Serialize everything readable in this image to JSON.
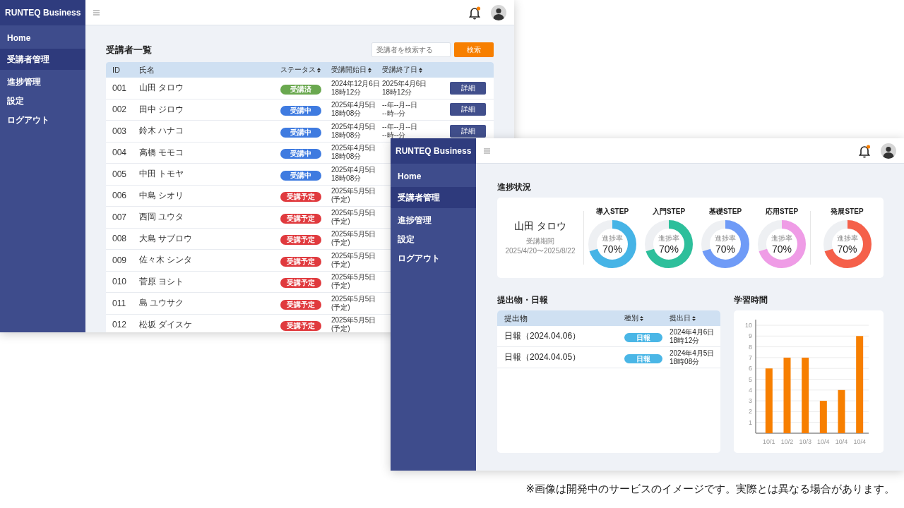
{
  "student_list_window": {
    "brand": "RUNTEQ Business",
    "notification": true,
    "sidebar": [
      {
        "label": "Home",
        "selected": false
      },
      {
        "label": "受講者管理",
        "selected": true
      },
      {
        "label": "進捗管理",
        "selected": false
      },
      {
        "label": "設定",
        "selected": false
      },
      {
        "label": "ログアウト",
        "selected": false
      }
    ],
    "title": "受講者一覧",
    "search": {
      "placeholder": "受講者を検索する"
    },
    "search_button": "検索",
    "table": {
      "columns": [
        {
          "label": "ID",
          "sortable": false
        },
        {
          "label": "氏名",
          "sortable": false
        },
        {
          "label": "ステータス",
          "sortable": true
        },
        {
          "label": "受講開始日",
          "sortable": true
        },
        {
          "label": "受講終了日",
          "sortable": true
        }
      ],
      "rows": [
        {
          "id": "001",
          "name": "山田 タロウ",
          "status": {
            "label": "受講済",
            "kind": "done"
          },
          "start": [
            "2024年12月6日",
            "18時12分"
          ],
          "end": [
            "2025年4月6日",
            "18時12分"
          ],
          "button": "詳細"
        },
        {
          "id": "002",
          "name": "田中 ジロウ",
          "status": {
            "label": "受講中",
            "kind": "active"
          },
          "start": [
            "2025年4月5日",
            "18時08分"
          ],
          "end": [
            "--年--月--日",
            "--時--分"
          ],
          "button": "詳細"
        },
        {
          "id": "003",
          "name": "鈴木 ハナコ",
          "status": {
            "label": "受講中",
            "kind": "active"
          },
          "start": [
            "2025年4月5日",
            "18時08分"
          ],
          "end": [
            "--年--月--日",
            "--時--分"
          ],
          "button": "詳細"
        },
        {
          "id": "004",
          "name": "高橋 モモコ",
          "status": {
            "label": "受講中",
            "kind": "active"
          },
          "start": [
            "2025年4月5日",
            "18時08分"
          ]
        },
        {
          "id": "005",
          "name": "中田 トモヤ",
          "status": {
            "label": "受講中",
            "kind": "active"
          },
          "start": [
            "2025年4月5日",
            "18時08分"
          ]
        },
        {
          "id": "006",
          "name": "中島 シオリ",
          "status": {
            "label": "受講予定",
            "kind": "planned"
          },
          "start": [
            "2025年5月5日",
            "(予定)"
          ]
        },
        {
          "id": "007",
          "name": "西岡 ユウタ",
          "status": {
            "label": "受講予定",
            "kind": "planned"
          },
          "start": [
            "2025年5月5日",
            "(予定)"
          ]
        },
        {
          "id": "008",
          "name": "大島 サブロウ",
          "status": {
            "label": "受講予定",
            "kind": "planned"
          },
          "start": [
            "2025年5月5日",
            "(予定)"
          ]
        },
        {
          "id": "009",
          "name": "佐々木 シンタ",
          "status": {
            "label": "受講予定",
            "kind": "planned"
          },
          "start": [
            "2025年5月5日",
            "(予定)"
          ]
        },
        {
          "id": "010",
          "name": "菅原 ヨシト",
          "status": {
            "label": "受講予定",
            "kind": "planned"
          },
          "start": [
            "2025年5月5日",
            "(予定)"
          ]
        },
        {
          "id": "011",
          "name": "島 ユウサク",
          "status": {
            "label": "受講予定",
            "kind": "planned"
          },
          "start": [
            "2025年5月5日",
            "(予定)"
          ]
        },
        {
          "id": "012",
          "name": "松坂 ダイスケ",
          "status": {
            "label": "受講予定",
            "kind": "planned"
          },
          "start": [
            "2025年5月5日",
            "(予定)"
          ]
        }
      ]
    }
  },
  "progress_window": {
    "brand": "RUNTEQ Business",
    "notification": true,
    "sidebar": [
      {
        "label": "Home",
        "selected": false
      },
      {
        "label": "受講者管理",
        "selected": true
      },
      {
        "label": "進捗管理",
        "selected": false
      },
      {
        "label": "設定",
        "selected": false
      },
      {
        "label": "ログアウト",
        "selected": false
      }
    ],
    "progress": {
      "title": "進捗状況",
      "student": {
        "name": "山田 タロウ",
        "period_label": "受講期間",
        "period": "2025/4/20〜2025/8/22"
      },
      "steps": [
        {
          "label": "導入STEP",
          "caption": "進捗率",
          "reading": "70%",
          "level": 0.7,
          "color": "#46b4e6"
        },
        {
          "label": "入門STEP",
          "caption": "進捗率",
          "reading": "70%",
          "level": 0.7,
          "color": "#2dbf9b"
        },
        {
          "label": "基礎STEP",
          "caption": "進捗率",
          "reading": "70%",
          "level": 0.7,
          "color": "#6f9bf7"
        },
        {
          "label": "応用STEP",
          "caption": "進捗率",
          "reading": "70%",
          "level": 0.7,
          "color": "#ef9ce6"
        },
        {
          "label": "発展STEP",
          "caption": "進捗率",
          "reading": "70%",
          "level": 0.7,
          "color": "#f5604a"
        }
      ]
    },
    "submissions": {
      "title": "提出物・日報",
      "columns": [
        {
          "label": "提出物",
          "sortable": false
        },
        {
          "label": "種別",
          "sortable": true
        },
        {
          "label": "提出日",
          "sortable": true
        }
      ],
      "rows": [
        {
          "name": "日報（2024.04.06）",
          "type": "日報",
          "date": [
            "2024年4月6日",
            "18時12分"
          ]
        },
        {
          "name": "日報（2024.04.05）",
          "type": "日報",
          "date": [
            "2024年4月5日",
            "18時08分"
          ]
        }
      ]
    },
    "study_time": {
      "title": "学習時間",
      "chart_data": {
        "type": "bar",
        "grid": true,
        "categories": [
          "10/1",
          "10/2",
          "10/3",
          "10/4",
          "10/4",
          "10/4"
        ],
        "values": [
          6,
          7,
          7,
          3,
          4,
          9
        ],
        "ylim": [
          0,
          10
        ],
        "yticks": [
          1,
          2,
          3,
          4,
          5,
          6,
          7,
          8,
          9,
          10
        ]
      }
    }
  },
  "footnote": "※画像は開発中のサービスのイメージです。実際とは異なる場合があります。"
}
